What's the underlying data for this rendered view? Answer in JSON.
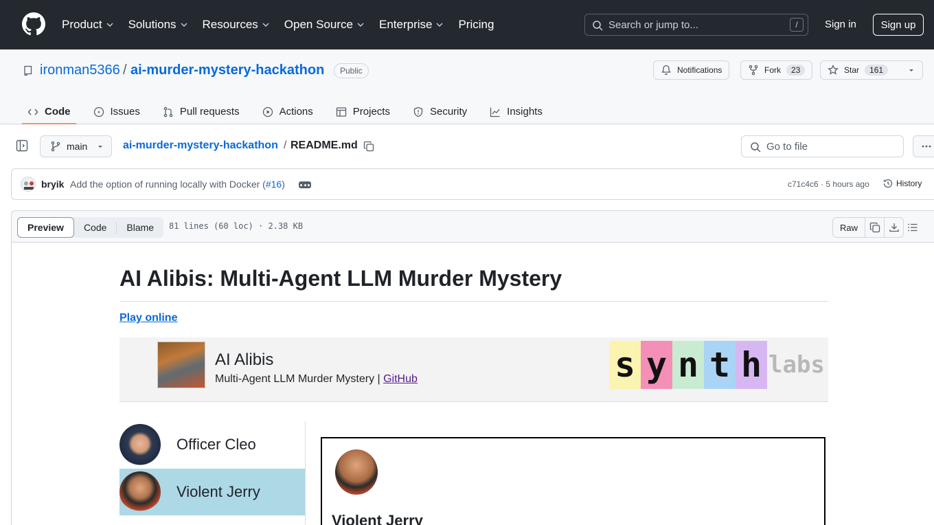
{
  "nav": {
    "items": [
      "Product",
      "Solutions",
      "Resources",
      "Open Source",
      "Enterprise",
      "Pricing"
    ],
    "search_placeholder": "Search or jump to...",
    "search_shortcut": "/",
    "signin": "Sign in",
    "signup": "Sign up"
  },
  "repo": {
    "owner": "ironman5366",
    "separator": "/",
    "name": "ai-murder-mystery-hackathon",
    "visibility": "Public",
    "notifications": "Notifications",
    "fork_label": "Fork",
    "fork_count": "23",
    "star_label": "Star",
    "star_count": "161"
  },
  "tabs": [
    {
      "label": "Code",
      "icon": "code-icon",
      "active": true
    },
    {
      "label": "Issues",
      "icon": "issue-icon"
    },
    {
      "label": "Pull requests",
      "icon": "pull-request-icon"
    },
    {
      "label": "Actions",
      "icon": "play-icon"
    },
    {
      "label": "Projects",
      "icon": "table-icon"
    },
    {
      "label": "Security",
      "icon": "shield-icon"
    },
    {
      "label": "Insights",
      "icon": "graph-icon"
    }
  ],
  "file": {
    "branch": "main",
    "crumb_repo": "ai-murder-mystery-hackathon",
    "crumb_sep": "/",
    "crumb_file": "README.md",
    "goto_placeholder": "Go to file"
  },
  "commit": {
    "author": "bryik",
    "message_prefix": "Add the option of running locally with Docker (",
    "pr_link": "#16",
    "message_suffix": ")",
    "sha": "c71c4c6",
    "sep": "·",
    "time": "5 hours ago",
    "history": "History"
  },
  "toolbar": {
    "preview": "Preview",
    "code": "Code",
    "blame": "Blame",
    "meta": "81 lines (60 loc) · 2.38 KB",
    "raw": "Raw"
  },
  "readme": {
    "title": "AI Alibis: Multi-Agent LLM Murder Mystery",
    "play_link": "Play online",
    "banner_title": "AI Alibis",
    "banner_sub": "Multi-Agent LLM Murder Mystery | ",
    "banner_github": "GitHub",
    "logo_letters": [
      "s",
      "y",
      "n",
      "t",
      "h"
    ],
    "logo_colors": [
      "#fbf3b0",
      "#f48fb8",
      "#c9ebd2",
      "#aad4f5",
      "#d7b7f2"
    ],
    "logo_suffix": "labs",
    "characters": [
      {
        "name": "Officer Cleo",
        "selected": false
      },
      {
        "name": "Violent Jerry",
        "selected": true
      }
    ],
    "selected_name": "Violent Jerry"
  }
}
